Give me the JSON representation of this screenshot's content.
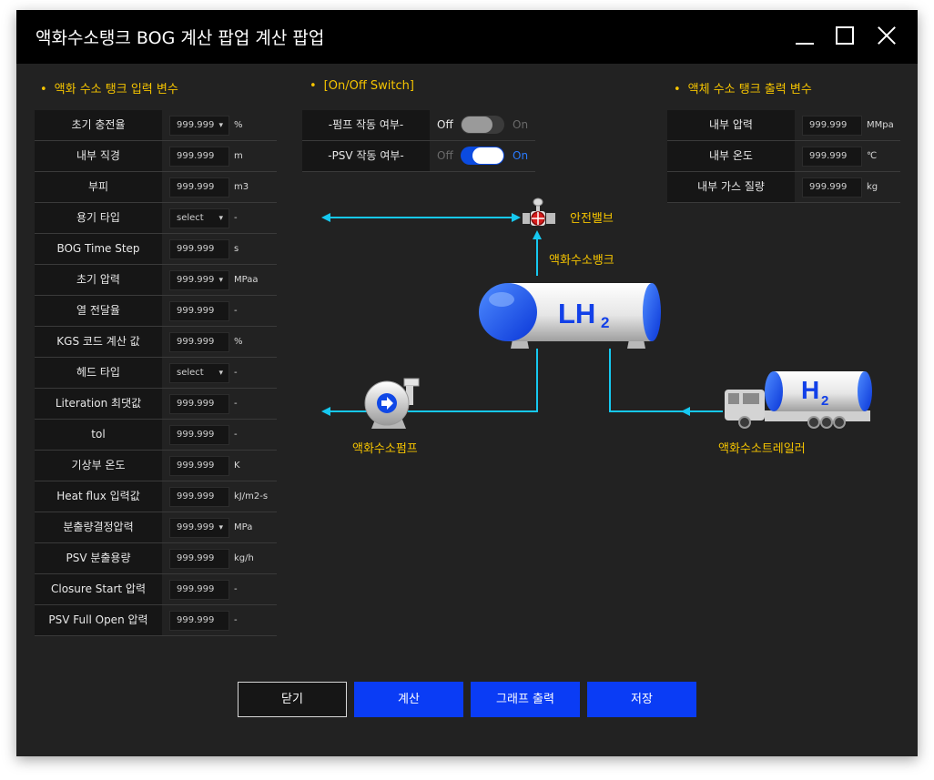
{
  "window": {
    "title": "액화수소탱크 BOG 계산 팝업 계산 팝업"
  },
  "input_section": {
    "title": "액화 수소 탱크 입력 변수",
    "rows": [
      {
        "label": "초기 충전율",
        "value": "999.999",
        "unit": "%",
        "select": true
      },
      {
        "label": "내부 직경",
        "value": "999.999",
        "unit": "m",
        "select": false
      },
      {
        "label": "부피",
        "value": "999.999",
        "unit": "m3",
        "select": false
      },
      {
        "label": "용기 타입",
        "value": "select",
        "unit": "-",
        "select": true
      },
      {
        "label": "BOG Time Step",
        "value": "999.999",
        "unit": "s",
        "select": false
      },
      {
        "label": "초기 압력",
        "value": "999.999",
        "unit": "MPaa",
        "select": true
      },
      {
        "label": "열 전달율",
        "value": "999.999",
        "unit": "-",
        "select": false
      },
      {
        "label": "KGS 코드 계산 값",
        "value": "999.999",
        "unit": "%",
        "select": false
      },
      {
        "label": "헤드 타입",
        "value": "select",
        "unit": "-",
        "select": true
      },
      {
        "label": "Literation 최댓값",
        "value": "999.999",
        "unit": "-",
        "select": false
      },
      {
        "label": "tol",
        "value": "999.999",
        "unit": "-",
        "select": false
      },
      {
        "label": "기상부 온도",
        "value": "999.999",
        "unit": "K",
        "select": false
      },
      {
        "label": "Heat flux 입력값",
        "value": "999.999",
        "unit": "kJ/m2-s",
        "select": false
      },
      {
        "label": "분출량결정압력",
        "value": "999.999",
        "unit": "MPa",
        "select": true
      },
      {
        "label": "PSV 분출용량",
        "value": "999.999",
        "unit": "kg/h",
        "select": false
      },
      {
        "label": "Closure Start 압력",
        "value": "999.999",
        "unit": "-",
        "select": false
      },
      {
        "label": "PSV Full Open 압력",
        "value": "999.999",
        "unit": "-",
        "select": false
      }
    ]
  },
  "switch_section": {
    "title": "[On/Off Switch]",
    "rows": [
      {
        "label": "-펌프 작동 여부-",
        "off": "Off",
        "on": "On",
        "state": "off"
      },
      {
        "label": "-PSV 작동 여부-",
        "off": "Off",
        "on": "On",
        "state": "on"
      }
    ]
  },
  "output_section": {
    "title": "액체 수소 탱크 출력 변수",
    "rows": [
      {
        "label": "내부 압력",
        "value": "999.999",
        "unit": "MMpa"
      },
      {
        "label": "내부 온도",
        "value": "999.999",
        "unit": "℃"
      },
      {
        "label": "내부 가스 질량",
        "value": "999.999",
        "unit": "kg"
      }
    ]
  },
  "diagram": {
    "valve_label": "안전밸브",
    "tank_label": "액화수소뱅크",
    "tank_text": "LH",
    "tank_sub": "2",
    "pump_label": "액화수소펌프",
    "trailer_label": "액화수소트레일러",
    "trailer_text": "H",
    "trailer_sub": "2",
    "line_color": "#16c8f0",
    "label_color": "#f5c400"
  },
  "buttons": {
    "close": "닫기",
    "calc": "계산",
    "graph": "그래프 출력",
    "save": "저장"
  },
  "colors": {
    "accent": "#0a3cf5",
    "title_bg": "#000000",
    "window_bg": "#222222"
  }
}
